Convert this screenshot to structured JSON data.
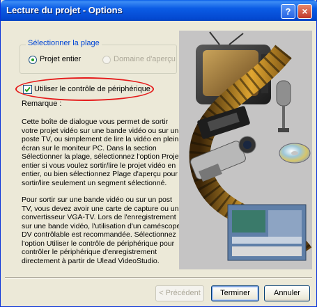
{
  "window": {
    "title": "Lecture du projet - Options",
    "help_label": "?",
    "close_label": "×"
  },
  "range_group": {
    "legend": "Sélectionner la plage",
    "options": [
      {
        "label": "Projet entier",
        "selected": true,
        "enabled": true
      },
      {
        "label": "Domaine d'aperçu",
        "selected": false,
        "enabled": false
      }
    ]
  },
  "device_control": {
    "label": "Utiliser le contrôle de périphérique",
    "checked": true,
    "highlight_color": "#e51b1b"
  },
  "remark": {
    "title": "Remarque :",
    "paragraphs": [
      "Cette boîte de dialogue vous permet de sortir votre projet vidéo sur une bande vidéo ou sur un poste TV, ou simplement de lire la vidéo en plein écran sur le moniteur PC. Dans la section Sélectionner la plage, sélectionnez l'option Projet entier si vous voulez sortir/lire le projet vidéo en entier, ou bien sélectionnez Plage d'aperçu pour sortir/lire seulement un segment sélectionné.",
      "Pour sortir sur une bande vidéo ou sur un post TV, vous devez avoir une carte de capture ou un convertisseur VGA-TV. Lors de l'enregistrement sur une bande vidéo, l'utilisation d'un caméscope DV contrôlable est recommandée. Sélectionnez l'option Utiliser le contrôle de périphérique pour contrôler le périphérique d'enregistrement directement à partir de Ulead VideoStudio."
    ]
  },
  "buttons": {
    "previous": "< Précédent",
    "finish": "Terminer",
    "cancel": "Annuler"
  },
  "colors": {
    "titlebar": "#0b5ce5",
    "dialog_bg": "#ece9d8",
    "group_legend": "#0046d5"
  }
}
